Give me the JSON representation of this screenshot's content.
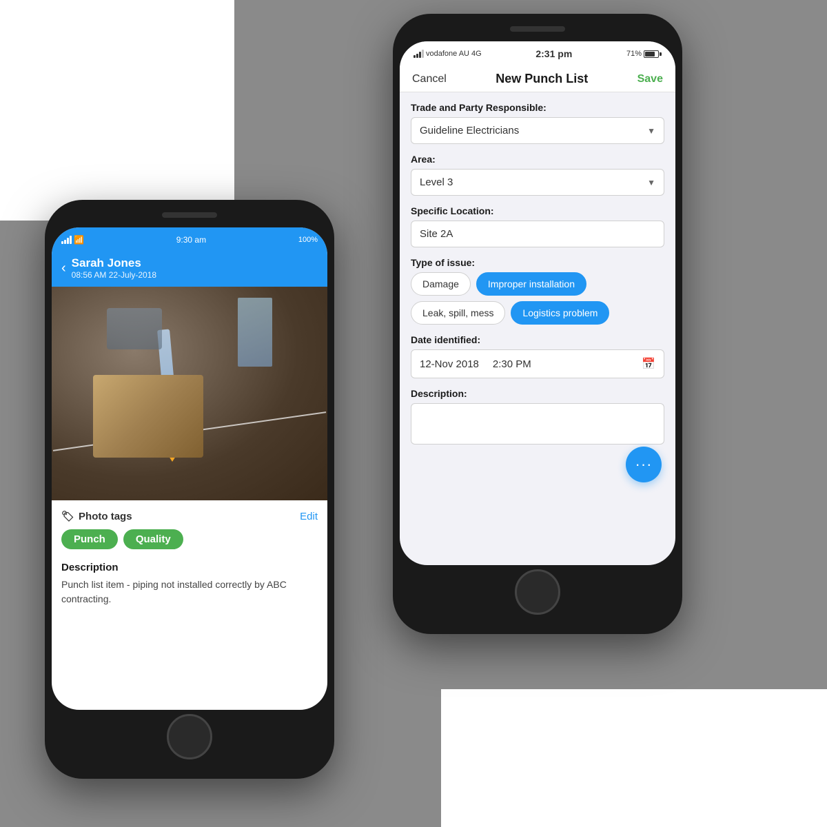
{
  "background": "#8a8a8a",
  "left_phone": {
    "status_bar": {
      "time": "9:30 am",
      "battery": "100%"
    },
    "header": {
      "name": "Sarah Jones",
      "date": "08:56 AM 22-July-2018",
      "back_label": "‹"
    },
    "photo_tags": {
      "section_label": "Photo tags",
      "edit_label": "Edit",
      "tags": [
        "Punch",
        "Quality"
      ]
    },
    "description": {
      "title": "Description",
      "text": "Punch list item - piping not installed correctly by ABC contracting."
    }
  },
  "right_phone": {
    "status_bar": {
      "carrier": "vodafone AU",
      "network": "4G",
      "time": "2:31 pm",
      "battery": "71%"
    },
    "nav": {
      "cancel_label": "Cancel",
      "title": "New Punch List",
      "save_label": "Save"
    },
    "form": {
      "trade_label": "Trade and Party Responsible:",
      "trade_value": "Guideline Electricians",
      "area_label": "Area:",
      "area_value": "Level 3",
      "location_label": "Specific Location:",
      "location_value": "Site 2A",
      "issue_label": "Type of issue:",
      "issue_types": [
        {
          "label": "Damage",
          "active": false
        },
        {
          "label": "Improper installation",
          "active": true
        },
        {
          "label": "Leak, spill, mess",
          "active": false
        },
        {
          "label": "Logistics problem",
          "active": true
        }
      ],
      "date_label": "Date identified:",
      "date_value": "12-Nov 2018",
      "time_value": "2:30 PM",
      "description_label": "Description:"
    },
    "fab": "···"
  }
}
